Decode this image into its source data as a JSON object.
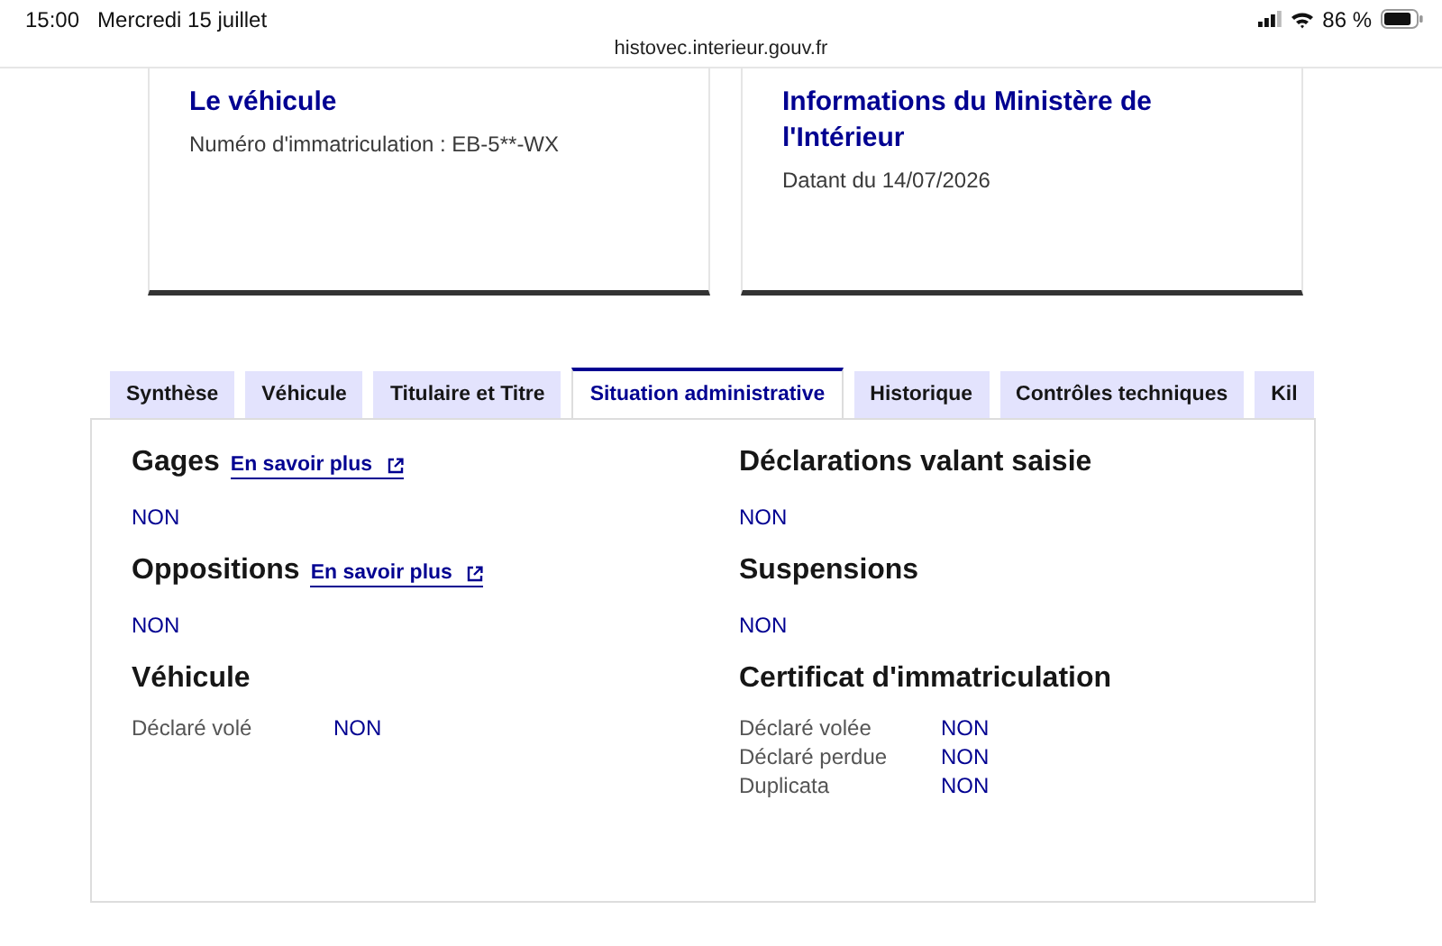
{
  "status_bar": {
    "time": "15:00",
    "date": "Mercredi 15 juillet",
    "battery_text": "86 %"
  },
  "url": "histovec.interieur.gouv.fr",
  "cards": [
    {
      "title": "Le véhicule",
      "text": "Numéro d'immatriculation : EB-5**-WX"
    },
    {
      "title": "Informations du Ministère de l'Intérieur",
      "text": "Datant du 14/07/2026"
    }
  ],
  "tabs": [
    {
      "label": "Synthèse",
      "selected": false
    },
    {
      "label": "Véhicule",
      "selected": false
    },
    {
      "label": "Titulaire et Titre",
      "selected": false
    },
    {
      "label": "Situation administrative",
      "selected": true
    },
    {
      "label": "Historique",
      "selected": false
    },
    {
      "label": "Contrôles techniques",
      "selected": false
    },
    {
      "label": "Kil",
      "selected": false
    }
  ],
  "columns": [
    [
      {
        "kind": "value",
        "title": "Gages",
        "link": "En savoir plus",
        "value": "NON"
      },
      {
        "kind": "value",
        "title": "Oppositions",
        "link": "En savoir plus",
        "value": "NON"
      },
      {
        "kind": "rows",
        "title": "Véhicule",
        "rows": [
          {
            "label": "Déclaré volé",
            "value": "NON"
          }
        ]
      }
    ],
    [
      {
        "kind": "value",
        "title": "Déclarations valant saisie",
        "value": "NON"
      },
      {
        "kind": "value",
        "title": "Suspensions",
        "value": "NON"
      },
      {
        "kind": "rows",
        "title": "Certificat d'immatriculation",
        "rows": [
          {
            "label": "Déclaré volée",
            "value": "NON"
          },
          {
            "label": "Déclaré perdue",
            "value": "NON"
          },
          {
            "label": "Duplicata",
            "value": "NON"
          }
        ]
      }
    ]
  ]
}
